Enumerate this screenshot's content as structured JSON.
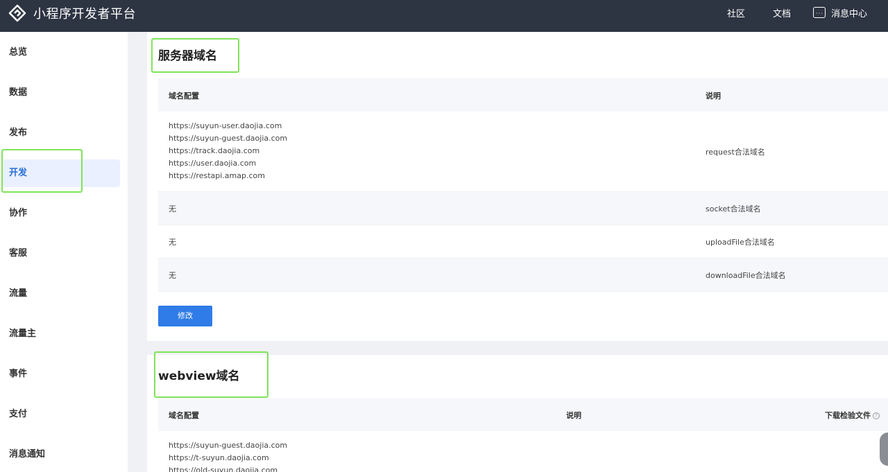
{
  "app": {
    "title": "小程序开发者平台"
  },
  "topnav": {
    "community": "社区",
    "docs": "文档",
    "messages": "消息中心"
  },
  "sidebar": {
    "items": [
      "总览",
      "数据",
      "发布",
      "开发",
      "协作",
      "客服",
      "流量",
      "流量主",
      "事件",
      "支付",
      "消息通知"
    ],
    "active": "开发"
  },
  "server_domains": {
    "title": "服务器域名",
    "headers": {
      "config": "域名配置",
      "desc": "说明"
    },
    "rows": [
      {
        "domains": [
          "https://suyun-user.daojia.com",
          "https://suyun-guest.daojia.com",
          "https://track.daojia.com",
          "https://user.daojia.com",
          "https://restapi.amap.com"
        ],
        "desc": "request合法域名"
      },
      {
        "domains": [
          "无"
        ],
        "desc": "socket合法域名"
      },
      {
        "domains": [
          "无"
        ],
        "desc": "uploadFile合法域名"
      },
      {
        "domains": [
          "无"
        ],
        "desc": "downloadFile合法域名"
      }
    ],
    "modify_button": "修改"
  },
  "webview_domains": {
    "title": "webview域名",
    "headers": {
      "config": "域名配置",
      "desc": "说明",
      "file": "下载检验文件"
    },
    "rows": [
      {
        "domains": [
          "https://suyun-guest.daojia.com",
          "https://t-suyun.daojia.com",
          "https://old-suyun.daojia.com"
        ],
        "desc": ""
      }
    ]
  },
  "colors": {
    "topbar": "#2d3442",
    "accent": "#2f7ce8",
    "highlight": "#7fe35a",
    "active_nav_bg": "#eaf0ff"
  }
}
